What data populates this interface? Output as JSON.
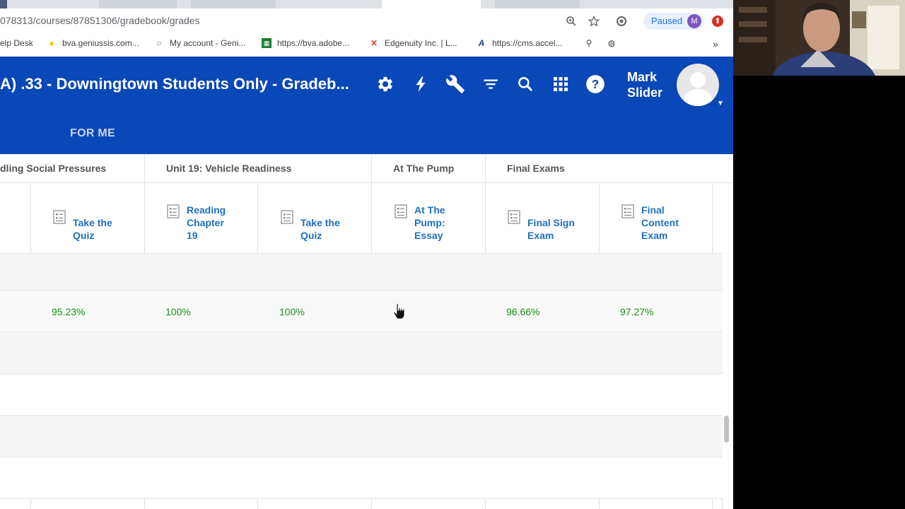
{
  "browser": {
    "url": "078313/courses/87851306/gradebook/grades",
    "paused_label": "Paused",
    "profile_initial": "M",
    "bookmarks": [
      {
        "label": "elp Desk",
        "icon": "none"
      },
      {
        "label": "bva.geniussis.com...",
        "icon": "lightbulb-icon"
      },
      {
        "label": "My account - Geni...",
        "icon": "bulb-outline-icon"
      },
      {
        "label": "https://bva.adobe...",
        "icon": "sheet-icon"
      },
      {
        "label": "Edgenuity Inc. | L...",
        "icon": "edgenuity-icon"
      },
      {
        "label": "https://cms.accel...",
        "icon": "accel-icon"
      }
    ],
    "more_bookmarks": "»"
  },
  "header": {
    "course_title": "A) .33 - Downingtown Students Only - Gradeb...",
    "user_first": "Mark",
    "user_last": "Slider",
    "for_me_tab": "FOR ME",
    "icons": [
      "settings-icon",
      "lightning-icon",
      "wrench-icon",
      "filter-icon",
      "search-icon",
      "apps-grid-icon",
      "help-icon"
    ]
  },
  "gradebook": {
    "units": [
      "dling Social Pressures",
      "Unit 19: Vehicle Readiness",
      "At The Pump",
      "Final Exams"
    ],
    "columns": [
      {
        "title": [
          "Take the",
          "Quiz"
        ]
      },
      {
        "title": [
          "Reading",
          "Chapter",
          "19"
        ]
      },
      {
        "title": [
          "Take the",
          "Quiz"
        ]
      },
      {
        "title": [
          "At The",
          "Pump:",
          "Essay"
        ]
      },
      {
        "title": [
          "Final Sign",
          "Exam"
        ]
      },
      {
        "title": [
          "Final",
          "Content",
          "Exam"
        ]
      }
    ],
    "scores": [
      "95.23%",
      "100%",
      "100%",
      "",
      "96.66%",
      "97.27%"
    ],
    "score_color": "#1a8a1a",
    "link_color": "#1f6fbf",
    "header_color": "#0a47b8"
  }
}
